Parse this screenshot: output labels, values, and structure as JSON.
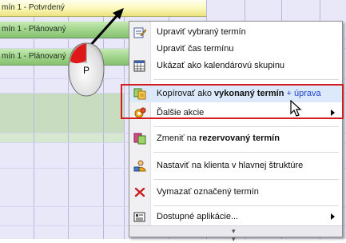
{
  "calendar": {
    "events": [
      {
        "label": "mín 1 - Potvrdený",
        "status": "confirmed"
      },
      {
        "label": "mín 1 - Plánovaný",
        "status": "planned"
      },
      {
        "label": "mín 1 - Plánovaný",
        "status": "planned"
      }
    ]
  },
  "mouse": {
    "letter": "P"
  },
  "context_menu": {
    "items": [
      {
        "id": "edit",
        "icon": "edit-note-icon",
        "label": "Upraviť vybraný termín"
      },
      {
        "id": "edit-time",
        "icon": "",
        "label": "Upraviť čas termínu"
      },
      {
        "id": "calendar-group",
        "icon": "calendar-grid-icon",
        "label": "Ukázať ako kalendárovú skupinu"
      },
      {
        "id": "copy-done",
        "icon": "copy-documents-icon",
        "label_prefix": "Kopírovať ako ",
        "label_bold": "vykonaný termín",
        "label_suffix": " + úprava",
        "highlighted": true
      },
      {
        "id": "more-actions",
        "icon": "gear-actions-icon",
        "label": "Ďalšie akcie",
        "submenu": true
      },
      {
        "id": "change-reserved",
        "icon": "change-document-icon",
        "label_prefix": "Zmeniť na ",
        "label_bold": "rezervovaný termín"
      },
      {
        "id": "set-client",
        "icon": "person-icon",
        "label": "Nastaviť na klienta v hlavnej štruktúre"
      },
      {
        "id": "delete",
        "icon": "delete-x-icon",
        "label": "Vymazať označený termín"
      },
      {
        "id": "apps",
        "icon": "applications-icon",
        "label": "Dostupné aplikácie...",
        "submenu": true
      }
    ],
    "footer_icon": "chevron-double-down-icon"
  },
  "colors": {
    "highlight_border": "#d41c1c",
    "highlight_bg": "#dce9fb",
    "accent_text": "#2143c9",
    "planned_event": "#9ed389",
    "confirmed_event": "#fbf7b8"
  }
}
